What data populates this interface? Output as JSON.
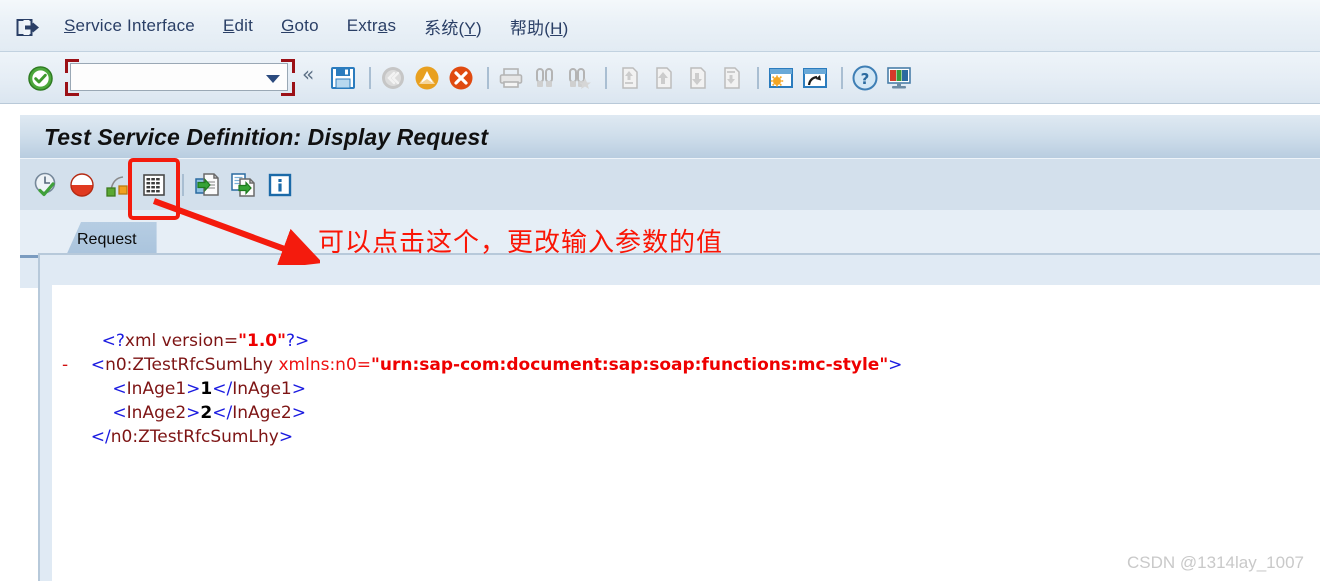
{
  "window": {
    "icon": "logoff-icon"
  },
  "menubar": {
    "items": [
      {
        "pre": "",
        "accel": "S",
        "post": "ervice Interface",
        "name": "menu-service-interface"
      },
      {
        "pre": "",
        "accel": "E",
        "post": "dit",
        "name": "menu-edit"
      },
      {
        "pre": "",
        "accel": "G",
        "post": "oto",
        "name": "menu-goto"
      },
      {
        "pre": "Extr",
        "accel": "a",
        "post": "s",
        "name": "menu-extras"
      },
      {
        "pre": "系统(",
        "accel": "Y",
        "post": ")",
        "name": "menu-system"
      },
      {
        "pre": "帮助(",
        "accel": "H",
        "post": ")",
        "name": "menu-help"
      }
    ]
  },
  "toolbar": {
    "command_field_value": "",
    "command_field_placeholder": "",
    "icons": [
      "save-icon",
      "back-icon",
      "exit-icon",
      "cancel-icon",
      "print-icon",
      "find-icon",
      "find-next-icon",
      "first-page-icon",
      "previous-page-icon",
      "next-page-icon",
      "last-page-icon",
      "create-session-icon",
      "create-shortcut-icon",
      "help-icon",
      "customize-layout-icon"
    ],
    "collapse_label": "«"
  },
  "title": {
    "text": "Test Service Definition: Display Request"
  },
  "apptoolbar": {
    "icons": [
      "execute-clock-icon",
      "status-pie-icon",
      "structure-icon",
      "edit-xml-grid-icon",
      "export-document-icon",
      "import-document-icon",
      "information-icon"
    ]
  },
  "tabs": [
    {
      "label": "Request",
      "name": "tab-request",
      "active": true
    }
  ],
  "xml": {
    "lines": [
      [
        {
          "t": "ang",
          "v": "    <?"
        },
        {
          "t": "tag",
          "v": "xml version="
        },
        {
          "t": "val",
          "v": "\"1.0\""
        },
        {
          "t": "ang",
          "v": "?>"
        }
      ],
      [
        {
          "t": "ang",
          "v": "  <"
        },
        {
          "t": "tag",
          "v": "n0:ZTestRfcSumLhy "
        },
        {
          "t": "attr",
          "v": "xmlns:n0="
        },
        {
          "t": "val",
          "v": "\"urn:sap-com:document:sap:soap:functions:mc-style\""
        },
        {
          "t": "ang",
          "v": ">"
        }
      ],
      [
        {
          "t": "ang",
          "v": "      <"
        },
        {
          "t": "tag",
          "v": "InAge1"
        },
        {
          "t": "ang",
          "v": ">"
        },
        {
          "t": "txt",
          "v": "1"
        },
        {
          "t": "ang",
          "v": "</"
        },
        {
          "t": "tag",
          "v": "InAge1"
        },
        {
          "t": "ang",
          "v": ">"
        }
      ],
      [
        {
          "t": "ang",
          "v": "      <"
        },
        {
          "t": "tag",
          "v": "InAge2"
        },
        {
          "t": "ang",
          "v": ">"
        },
        {
          "t": "txt",
          "v": "2"
        },
        {
          "t": "ang",
          "v": "</"
        },
        {
          "t": "tag",
          "v": "InAge2"
        },
        {
          "t": "ang",
          "v": ">"
        }
      ],
      [
        {
          "t": "ang",
          "v": "  </"
        },
        {
          "t": "tag",
          "v": "n0:ZTestRfcSumLhy"
        },
        {
          "t": "ang",
          "v": ">"
        }
      ]
    ],
    "collapse_marker": "-"
  },
  "annotation": {
    "text": "可以点击这个，更改输入参数的值",
    "color": "#fa1505",
    "highlight_target": "edit-xml-grid-icon"
  },
  "watermark": {
    "text": "CSDN @1314lay_1007"
  },
  "colors": {
    "annotation_red": "#fa1505",
    "title_bg": "#cfdeeb",
    "toolbar_bg": "#e5edf5",
    "tab_active": "#b6cde3",
    "xml_tag": "#7d1414",
    "xml_bracket": "#1a1ae0",
    "xml_value": "#ee0000"
  }
}
